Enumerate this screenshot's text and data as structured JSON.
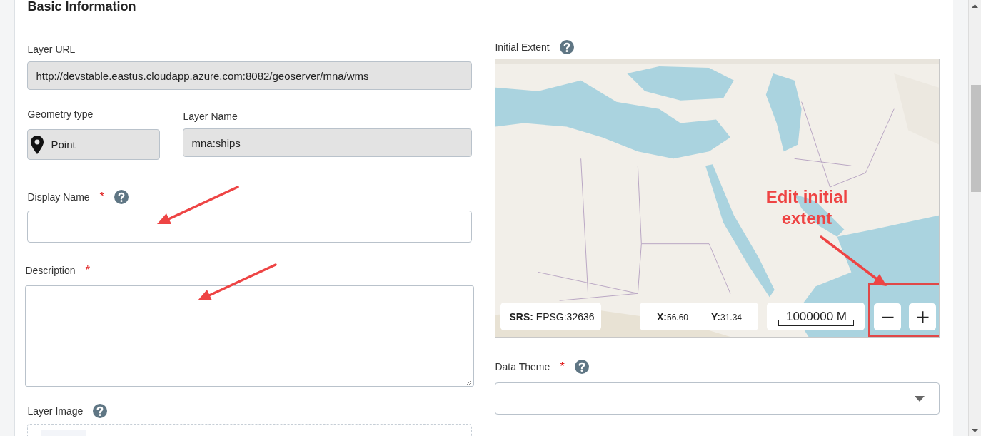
{
  "section": {
    "title": "Basic Information"
  },
  "layer_url": {
    "label": "Layer URL",
    "value": "http://devstable.eastus.cloudapp.azure.com:8082/geoserver/mna/wms"
  },
  "geometry_type": {
    "label": "Geometry type",
    "value": "Point"
  },
  "layer_name": {
    "label": "Layer Name",
    "value": "mna:ships"
  },
  "display_name": {
    "label": "Display Name",
    "required_mark": "*",
    "help": true
  },
  "description": {
    "label": "Description",
    "required_mark": "*"
  },
  "layer_image": {
    "label": "Layer Image",
    "help": true
  },
  "initial_extent": {
    "label": "Initial Extent",
    "help": true,
    "srs": {
      "label": "SRS:",
      "value": "EPSG:32636"
    },
    "x": {
      "label": "X:",
      "value": "56.60"
    },
    "y": {
      "label": "Y:",
      "value": "31.34"
    },
    "scale": "1000000 M",
    "zoom_buttons": [
      "−",
      "+"
    ],
    "zoom_highlighted": true
  },
  "data_theme": {
    "label": "Data Theme",
    "required_mark": "*",
    "help": true
  },
  "annotation": {
    "text": "Edit initial extent"
  }
}
